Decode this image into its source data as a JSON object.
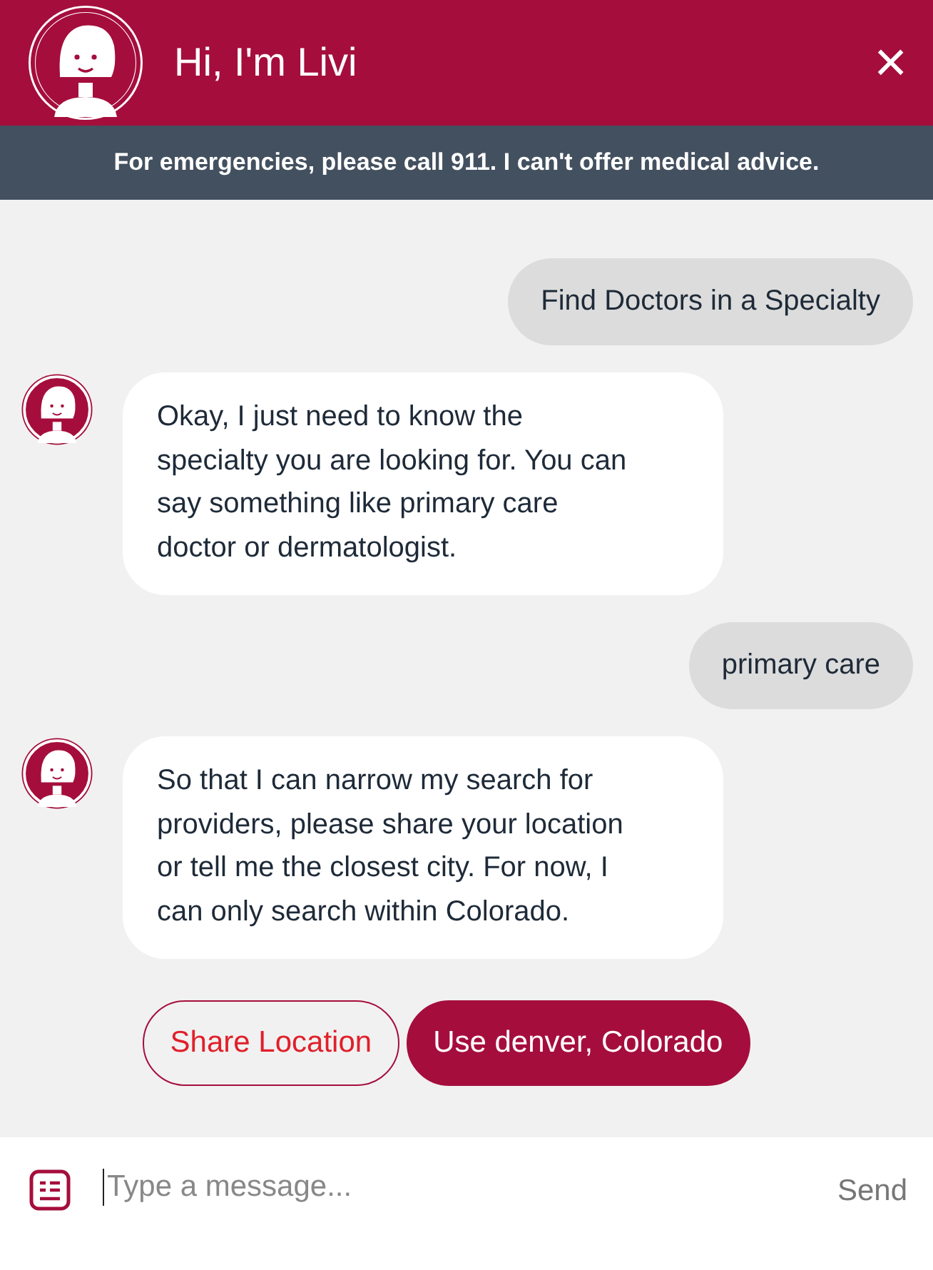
{
  "header": {
    "title": "Hi, I'm Livi",
    "close": "×"
  },
  "banner": "For emergencies, please call 911. I can't offer medical advice.",
  "messages": [
    {
      "kind": "user",
      "text": "Find Doctors in a Specialty"
    },
    {
      "kind": "bot",
      "text": "Okay, I just need to know the specialty you are looking for. You can say something like primary care doctor or dermatologist."
    },
    {
      "kind": "user",
      "text": "primary care"
    },
    {
      "kind": "bot",
      "text": "So that I can narrow my search for providers, please share your location or tell me the closest city. For now, I can only search within Colorado."
    }
  ],
  "quick_replies": [
    {
      "kind": "outline",
      "label": "Share Location"
    },
    {
      "kind": "filled",
      "label": "Use denver, Colorado"
    }
  ],
  "composer": {
    "placeholder": "Type a message...",
    "send": "Send"
  }
}
